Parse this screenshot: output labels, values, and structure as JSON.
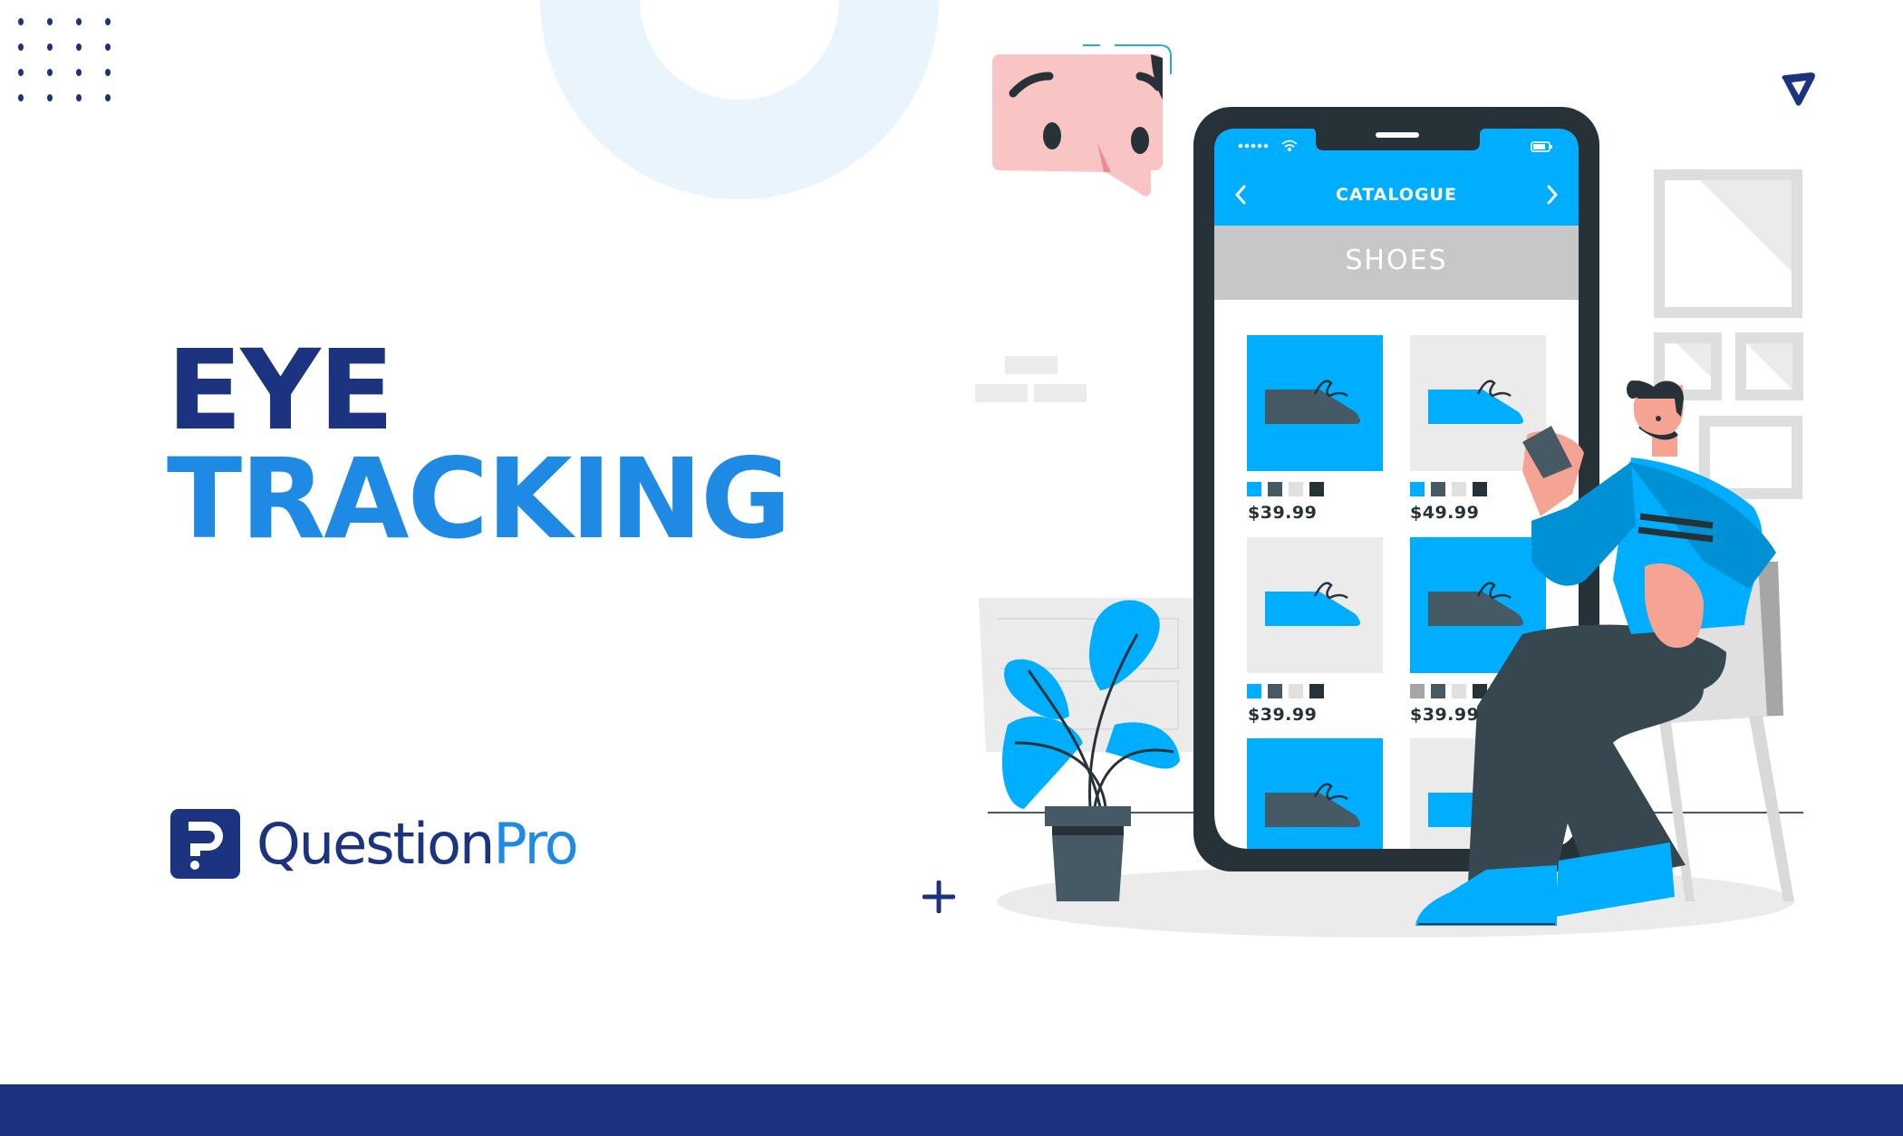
{
  "headline": {
    "line1": "EYE",
    "line2": "TRACKING"
  },
  "brand": {
    "name_part1": "Question",
    "name_part2": "Pro",
    "colors": {
      "navy": "#1c3380",
      "blue": "#1f8ae4"
    }
  },
  "phone": {
    "header_title": "CATALOGUE",
    "section_title": "SHOES",
    "back_icon": "chevron-left-icon",
    "forward_icon": "chevron-right-icon",
    "status_icons": [
      "signal-dots-icon",
      "wifi-icon",
      "battery-icon"
    ],
    "products": [
      {
        "price": "$39.99",
        "swatches": [
          "#00aeff",
          "#455a64",
          "#e0e0e0",
          "#263238"
        ],
        "tile_color": "#00aeff",
        "shoe_color": "#455a64"
      },
      {
        "price": "$49.99",
        "swatches": [
          "#00aeff",
          "#455a64",
          "#e0e0e0",
          "#263238"
        ],
        "tile_color": "#ebebeb",
        "shoe_color": "#00aeff"
      },
      {
        "price": "$39.99",
        "swatches": [
          "#00aeff",
          "#455a64",
          "#e0e0e0",
          "#263238"
        ],
        "tile_color": "#ebebeb",
        "shoe_color": "#00aeff"
      },
      {
        "price": "$39.99",
        "swatches": [
          "#a6a6a6",
          "#455a64",
          "#e0e0e0",
          "#263238"
        ],
        "tile_color": "#00aeff",
        "shoe_color": "#455a64"
      },
      {
        "price": "",
        "swatches": [],
        "tile_color": "#00aeff",
        "shoe_color": "#455a64"
      },
      {
        "price": "",
        "swatches": [],
        "tile_color": "#ebebeb",
        "shoe_color": "#00aeff"
      }
    ]
  },
  "decorations": {
    "dots_icon": "dot-grid-icon",
    "ring_icon": "ring-shape",
    "plus_icon": "plus-icon",
    "triangle_icon": "rounded-triangle-icon",
    "face_bubble_icon": "face-speech-bubble-icon"
  },
  "colors": {
    "footer_bar": "#1c3380",
    "ring": "#eaf4fc",
    "phone_frame": "#263238",
    "screen_accent": "#00aeff",
    "section_bar": "#c7c7c7"
  }
}
